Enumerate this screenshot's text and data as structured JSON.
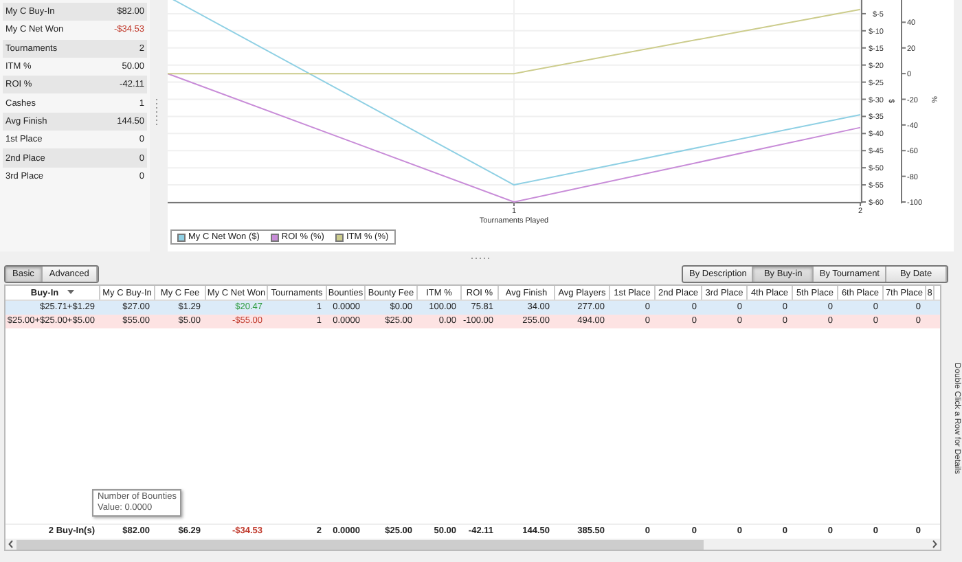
{
  "stats": [
    {
      "label": "My C Buy-In",
      "value": "$82.00",
      "kind": "plain"
    },
    {
      "label": "My C Net Won",
      "value": "-$34.53",
      "kind": "negative"
    },
    {
      "label": "Tournaments",
      "value": "2",
      "kind": "plain"
    },
    {
      "label": "ITM %",
      "value": "50.00",
      "kind": "plain"
    },
    {
      "label": "ROI %",
      "value": "-42.11",
      "kind": "plain"
    },
    {
      "label": "Cashes",
      "value": "1",
      "kind": "plain"
    },
    {
      "label": "Avg Finish",
      "value": "144.50",
      "kind": "plain"
    },
    {
      "label": "1st Place",
      "value": "0",
      "kind": "plain"
    },
    {
      "label": "2nd Place",
      "value": "0",
      "kind": "plain"
    },
    {
      "label": "3rd Place",
      "value": "0",
      "kind": "plain"
    }
  ],
  "chart": {
    "chart_data": {
      "type": "line",
      "xlabel": "Tournaments Played",
      "ylabel": "$",
      "y2label": "%",
      "x": [
        0,
        1,
        2
      ],
      "grid": true,
      "legend": "bottom-left",
      "xlim": [
        0,
        2
      ],
      "ylim": [
        -60,
        0
      ],
      "y2lim": [
        -100,
        60
      ],
      "xticks": [
        {
          "value": 1,
          "label": "1"
        },
        {
          "value": 2,
          "label": "2"
        }
      ],
      "yticks": [
        {
          "value": -5,
          "label": "$-5"
        },
        {
          "value": -10,
          "label": "$-10"
        },
        {
          "value": -15,
          "label": "$-15"
        },
        {
          "value": -20,
          "label": "$-20"
        },
        {
          "value": -25,
          "label": "$-25"
        },
        {
          "value": -30,
          "label": "$-30"
        },
        {
          "value": -35,
          "label": "$-35"
        },
        {
          "value": -40,
          "label": "$-40"
        },
        {
          "value": -45,
          "label": "$-45"
        },
        {
          "value": -50,
          "label": "$-50"
        },
        {
          "value": -55,
          "label": "$-55"
        },
        {
          "value": -60,
          "label": "$-60"
        }
      ],
      "y2ticks": [
        {
          "value": 40,
          "label": "40"
        },
        {
          "value": 20,
          "label": "20"
        },
        {
          "value": 0,
          "label": "0"
        },
        {
          "value": -20,
          "label": "-20"
        },
        {
          "value": -40,
          "label": "-40"
        },
        {
          "value": -60,
          "label": "-60"
        },
        {
          "value": -80,
          "label": "-80"
        },
        {
          "value": -100,
          "label": "-100"
        }
      ],
      "series": [
        {
          "name": "My C Net Won ($)",
          "color": "#8fd0e4",
          "axis": "y",
          "values": [
            0,
            -55,
            -34.5
          ]
        },
        {
          "name": "ROI % (%)",
          "color": "#c88cd8",
          "axis": "y2",
          "values": [
            0,
            -100,
            -42
          ]
        },
        {
          "name": "ITM % (%)",
          "color": "#cccc8c",
          "axis": "y2",
          "values": [
            0,
            0,
            50
          ]
        }
      ]
    }
  },
  "view_tabs": [
    {
      "label": "Basic",
      "selected": true
    },
    {
      "label": "Advanced",
      "selected": false
    }
  ],
  "group_tabs": [
    {
      "label": "By Description",
      "selected": false
    },
    {
      "label": "By Buy-in",
      "selected": true
    },
    {
      "label": "By Tournament",
      "selected": false
    },
    {
      "label": "By Date",
      "selected": false
    }
  ],
  "table": {
    "columns": [
      {
        "label": "Buy-In",
        "sorted": true
      },
      {
        "label": "My C Buy-In",
        "sorted": false
      },
      {
        "label": "My C Fee",
        "sorted": false
      },
      {
        "label": "My C Net Won",
        "sorted": false
      },
      {
        "label": "Tournaments",
        "sorted": false
      },
      {
        "label": "Bounties",
        "sorted": false
      },
      {
        "label": "Bounty Fee",
        "sorted": false
      },
      {
        "label": "ITM %",
        "sorted": false
      },
      {
        "label": "ROI %",
        "sorted": false
      },
      {
        "label": "Avg Finish",
        "sorted": false
      },
      {
        "label": "Avg Players",
        "sorted": false
      },
      {
        "label": "1st Place",
        "sorted": false
      },
      {
        "label": "2nd Place",
        "sorted": false
      },
      {
        "label": "3rd Place",
        "sorted": false
      },
      {
        "label": "4th Place",
        "sorted": false
      },
      {
        "label": "5th Place",
        "sorted": false
      },
      {
        "label": "6th Place",
        "sorted": false
      },
      {
        "label": "7th Place",
        "sorted": false
      },
      {
        "label": "8",
        "sorted": false
      }
    ],
    "rows": [
      {
        "selected": true,
        "cells": [
          "$25.71+$1.29",
          "$27.00",
          "$1.29",
          "$20.47",
          "1",
          "0.0000",
          "$0.00",
          "100.00",
          "75.81",
          "34.00",
          "277.00",
          "0",
          "0",
          "0",
          "0",
          "0",
          "0",
          "0"
        ]
      },
      {
        "selected": false,
        "cells": [
          "$25.00+$25.00+$5.00",
          "$55.00",
          "$5.00",
          "-$55.00",
          "1",
          "0.0000",
          "$25.00",
          "0.00",
          "-100.00",
          "255.00",
          "494.00",
          "0",
          "0",
          "0",
          "0",
          "0",
          "0",
          "0"
        ]
      }
    ],
    "totals": [
      "2 Buy-In(s)",
      "$82.00",
      "$6.29",
      "-$34.53",
      "2",
      "0.0000",
      "$25.00",
      "50.00",
      "-42.11",
      "144.50",
      "385.50",
      "0",
      "0",
      "0",
      "0",
      "0",
      "0",
      "0"
    ]
  },
  "tooltip": {
    "title": "Number of Bounties",
    "value": "Value: 0.0000"
  },
  "side_hint": "Double Click a Row for Details"
}
